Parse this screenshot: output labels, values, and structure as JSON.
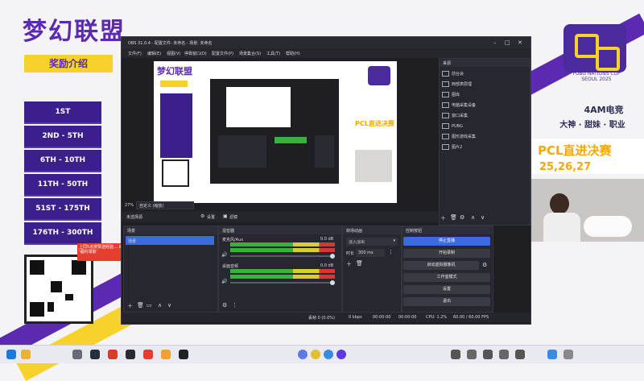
{
  "stream": {
    "title": "梦幻联盟",
    "subtitle": "奖励介绍",
    "ranks": [
      "1ST",
      "2ND - 5TH",
      "6TH - 10TH",
      "11TH - 50TH",
      "51ST - 175TH",
      "176TH - 300TH"
    ],
    "promo_note": "上同5点按赞送经验... 询问 '福利领取'",
    "brand": "4AM电竞",
    "tagline": "大神 · 甜妹 · 职业",
    "banner_line1": "PCL直进决赛",
    "banner_line2": "25,26,27",
    "pcl_caption": "PUBG NATIONS CUP SEOUL 2025"
  },
  "obs": {
    "window_title": "OBS 31.0.4 - 配置文件: 未命名 - 场景: 未命名",
    "menu": [
      "文件(F)",
      "编辑(E)",
      "视图(V)",
      "停靠窗口(D)",
      "配置文件(P)",
      "场景集合(S)",
      "工具(T)",
      "帮助(H)"
    ],
    "zoom": "27%",
    "zoom_option": "自定义 (缩放)",
    "toolbar_no_source": "未选择源",
    "toolbar_props": "设置",
    "toolbar_filters": "滤镜",
    "scenes_title": "场景",
    "scenes": [
      "场景"
    ],
    "mixer_title": "混音器",
    "mixer_channels": [
      {
        "name": "麦克风/Aux",
        "db": "0.0 dB"
      },
      {
        "name": "桌面音频",
        "db": "0.0 dB"
      }
    ],
    "transitions_title": "转场动画",
    "transition_type": "淡入淡出",
    "duration_label": "时长",
    "duration_value": "300 ms",
    "controls_title": "控制按钮",
    "controls": [
      "停止直播",
      "开始录制",
      "启动虚拟摄像机",
      "工作室模式",
      "设置",
      "退出"
    ],
    "sources_title": "来源",
    "sources": [
      "前台会",
      "西部表层理",
      "图库",
      "电脑采集设备",
      "窗口采集",
      "PUBG",
      "图形游戏采集",
      "图片2"
    ],
    "status_bitrate": "0 kbps",
    "status_dropped": "丢帧 0 (0.0%)",
    "status_time1": "00:00:00",
    "status_time2": "00:00:00",
    "status_cpu": "CPU: 1.2%",
    "status_fps": "60.00 / 60.00 FPS"
  },
  "colors": {
    "purple": "#5b2ab0",
    "yellow": "#f7d22a",
    "obs_bg": "#1f1f23",
    "accent_blue": "#3b6be0"
  }
}
